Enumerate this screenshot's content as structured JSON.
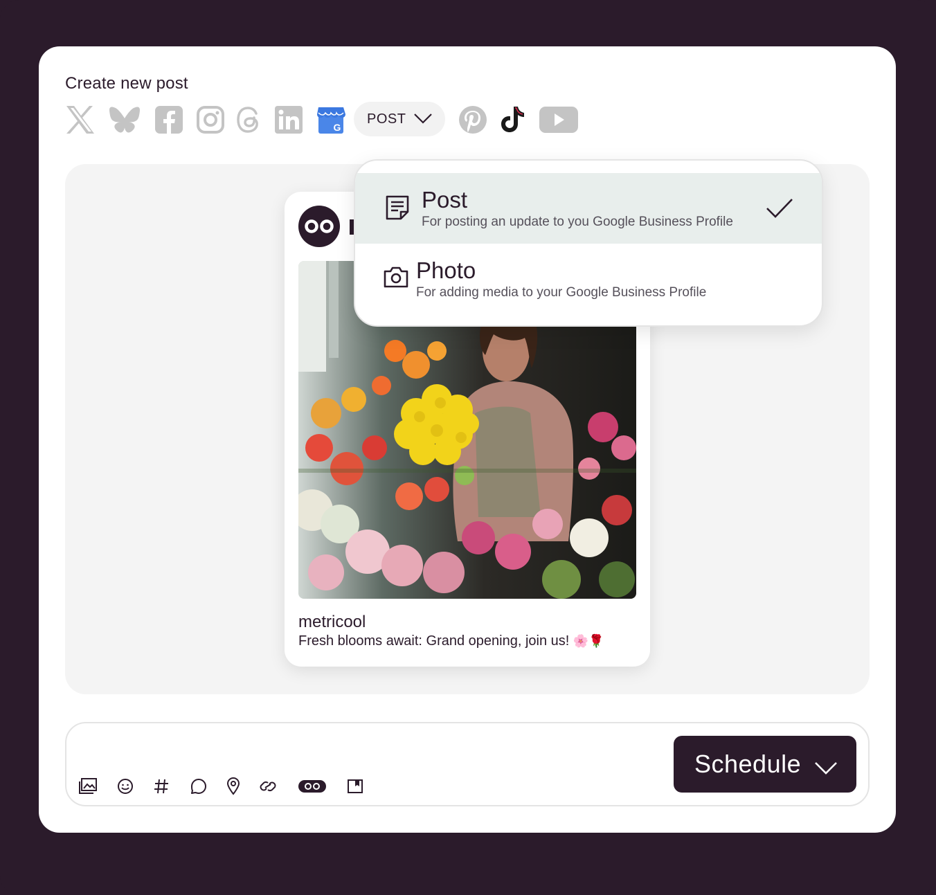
{
  "composer_title": "Create new post",
  "networks": [
    {
      "name": "x-icon",
      "active": false
    },
    {
      "name": "bluesky-icon",
      "active": false
    },
    {
      "name": "facebook-icon",
      "active": false
    },
    {
      "name": "instagram-icon",
      "active": false
    },
    {
      "name": "threads-icon",
      "active": false
    },
    {
      "name": "linkedin-icon",
      "active": false
    },
    {
      "name": "google-business-icon",
      "active": true
    },
    {
      "name": "pinterest-icon",
      "active": false
    },
    {
      "name": "tiktok-icon",
      "active": true
    },
    {
      "name": "youtube-icon",
      "active": false
    }
  ],
  "post_type_selector": {
    "label": "POST"
  },
  "dropdown": {
    "options": [
      {
        "label": "Post",
        "description": "For posting an update to you Google Business Profile",
        "selected": true,
        "icon": "note-icon"
      },
      {
        "label": "Photo",
        "description": "For adding media to your Google Business Profile",
        "selected": false,
        "icon": "camera-icon"
      }
    ]
  },
  "preview": {
    "account_name": "metricool",
    "caption": "Fresh blooms await: Grand opening, join us!",
    "caption_emoji": "🌸🌹"
  },
  "toolbar": {
    "tools": [
      "media-icon",
      "emoji-icon",
      "hashtag-icon",
      "comment-icon",
      "location-icon",
      "link-icon",
      "metricool-icon",
      "library-icon"
    ]
  },
  "schedule_button": {
    "label": "Schedule"
  },
  "colors": {
    "brand_dark": "#2b1b2b",
    "inactive_icon": "#bdbdbd",
    "gbp_blue": "#4a86e8",
    "selected_bg": "#e8eeec"
  }
}
